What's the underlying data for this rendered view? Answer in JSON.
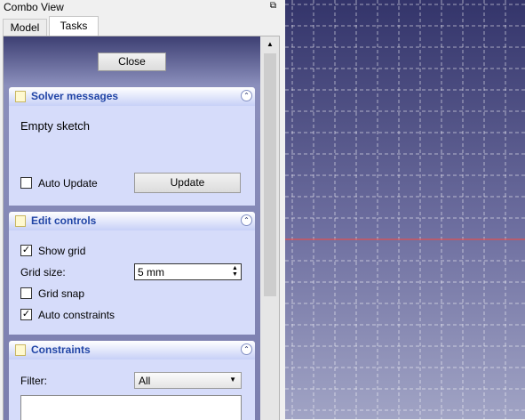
{
  "panel": {
    "title": "Combo View",
    "float_glyph": "⧉",
    "tabs": [
      {
        "label": "Model"
      },
      {
        "label": "Tasks"
      }
    ]
  },
  "close_button": "Close",
  "solver": {
    "title": "Solver messages",
    "message": "Empty sketch",
    "auto_update_label": "Auto Update",
    "auto_update_checked": false,
    "update_button": "Update"
  },
  "edit_controls": {
    "title": "Edit controls",
    "show_grid_label": "Show grid",
    "show_grid_checked": true,
    "grid_size_label": "Grid size:",
    "grid_size_value": "5 mm",
    "grid_snap_label": "Grid snap",
    "grid_snap_checked": false,
    "auto_constraints_label": "Auto constraints",
    "auto_constraints_checked": true
  },
  "constraints": {
    "title": "Constraints",
    "filter_label": "Filter:",
    "filter_value": "All"
  },
  "glyphs": {
    "collapse": "⌃",
    "check": "✓",
    "spin_up": "▲",
    "spin_down": "▼",
    "dropdown": "▼",
    "scroll_up": "▲"
  },
  "colors": {
    "section_title": "#2145a6",
    "viewport_top": "#33346a",
    "viewport_bottom": "#a1a4c5",
    "axis_line": "#e05050",
    "grid_line": "#ffffff"
  }
}
